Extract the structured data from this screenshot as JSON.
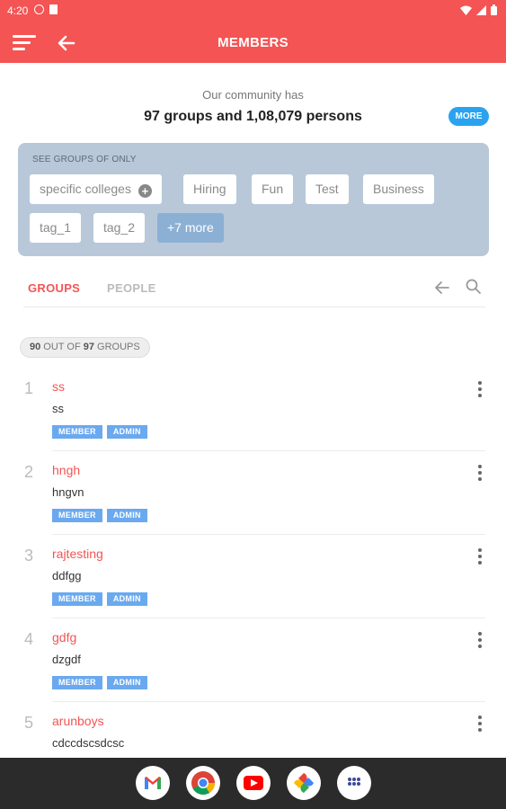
{
  "status_bar": {
    "time": "4:20",
    "icons": [
      "settings-status-icon",
      "sim-icon",
      "wifi-icon",
      "signal-icon",
      "battery-icon"
    ]
  },
  "app_bar": {
    "title": "MEMBERS",
    "icons": [
      "menu-icon",
      "back-arrow-icon"
    ],
    "color": "#f45454"
  },
  "community": {
    "intro": "Our community has",
    "stats": "97 groups and 1,08,079 persons",
    "more_label": "MORE"
  },
  "filters": {
    "heading": "SEE GROUPS OF ONLY",
    "chips": [
      {
        "label": "specific colleges",
        "icon": "plus-circle-icon"
      },
      {
        "label": "Hiring"
      },
      {
        "label": "Fun"
      },
      {
        "label": "Test"
      },
      {
        "label": "Business"
      },
      {
        "label": "tag_1"
      },
      {
        "label": "tag_2"
      },
      {
        "label": "+7 more"
      }
    ]
  },
  "tabs": {
    "items": [
      {
        "label": "GROUPS",
        "active": true
      },
      {
        "label": "PEOPLE",
        "active": false
      }
    ],
    "icons": [
      "back-arrow-icon",
      "search-icon"
    ]
  },
  "count_badge": {
    "shown": "90",
    "middle": " OUT OF ",
    "total": "97",
    "suffix": " GROUPS"
  },
  "groups": [
    {
      "index": "1",
      "name": "ss",
      "description": "ss",
      "badges": [
        "MEMBER",
        "ADMIN"
      ]
    },
    {
      "index": "2",
      "name": "hngh",
      "description": "hngvn",
      "badges": [
        "MEMBER",
        "ADMIN"
      ]
    },
    {
      "index": "3",
      "name": "rajtesting",
      "description": "ddfgg",
      "badges": [
        "MEMBER",
        "ADMIN"
      ]
    },
    {
      "index": "4",
      "name": "gdfg",
      "description": "dzgdf",
      "badges": [
        "MEMBER",
        "ADMIN"
      ]
    },
    {
      "index": "5",
      "name": "arunboys",
      "description": "cdccdscsdcsc",
      "badges": []
    }
  ],
  "dock": {
    "apps": [
      "gmail-icon",
      "chrome-icon",
      "youtube-icon",
      "photos-icon",
      "app-drawer-icon"
    ]
  }
}
